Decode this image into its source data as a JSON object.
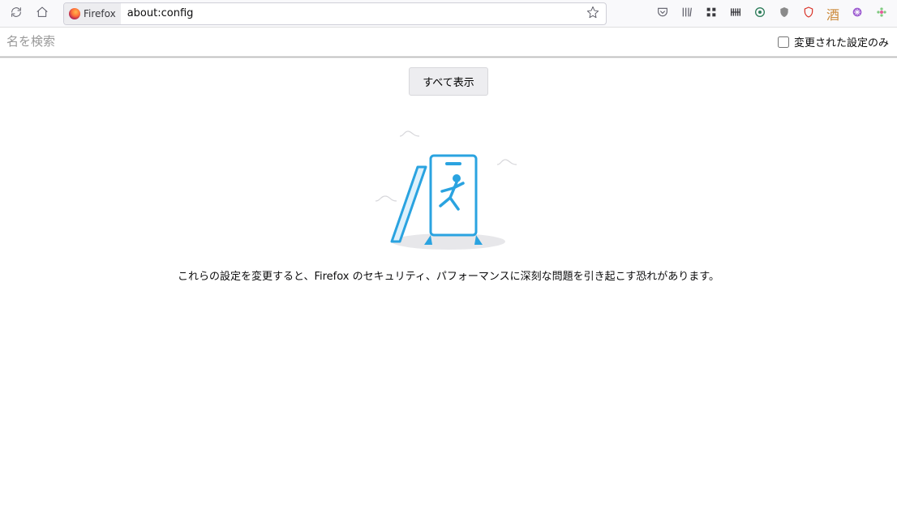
{
  "toolbar": {
    "identity_label": "Firefox",
    "url": "about:config"
  },
  "search": {
    "placeholder": "名を検索",
    "only_modified_label": "変更された設定のみ"
  },
  "main": {
    "show_all_label": "すべて表示",
    "warning_text": "これらの設定を変更すると、Firefox のセキュリティ、パフォーマンスに深刻な問題を引き起こす恐れがあります。"
  }
}
